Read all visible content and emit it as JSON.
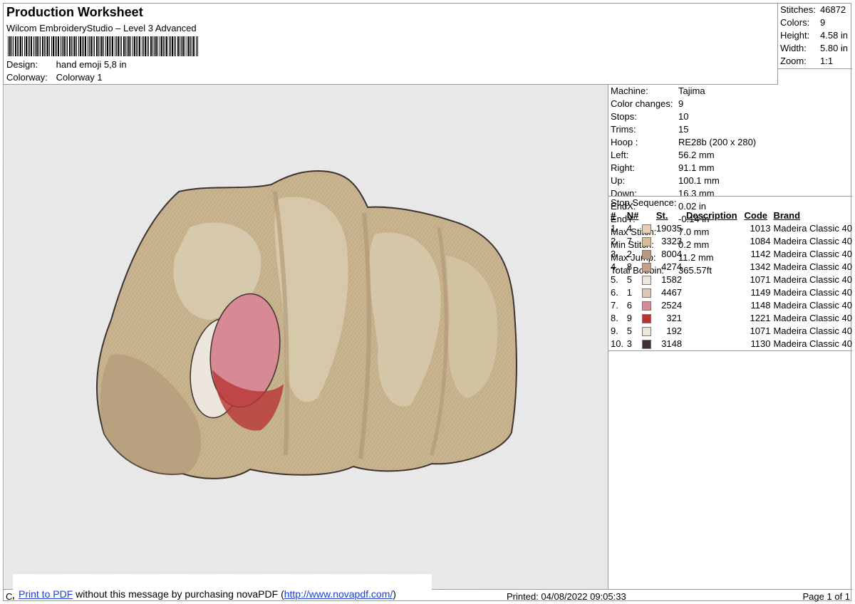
{
  "header": {
    "title": "Production Worksheet",
    "subtitle": "Wilcom EmbroideryStudio – Level 3 Advanced",
    "design_label": "Design:",
    "design_value": "hand emoji 5,8 in",
    "colorway_label": "Colorway:",
    "colorway_value": "Colorway 1"
  },
  "stats": [
    {
      "label": "Stitches:",
      "value": "46872"
    },
    {
      "label": "Colors:",
      "value": "9"
    },
    {
      "label": "Height:",
      "value": "4.58 in"
    },
    {
      "label": "Width:",
      "value": "5.80 in"
    },
    {
      "label": "Zoom:",
      "value": "1:1"
    }
  ],
  "machine_info": [
    {
      "label": "Machine:",
      "value": "Tajima"
    },
    {
      "label": "Color changes:",
      "value": "9"
    },
    {
      "label": "Stops:",
      "value": "10"
    },
    {
      "label": "Trims:",
      "value": "15"
    },
    {
      "label": "Hoop :",
      "value": "RE28b (200 x 280)"
    },
    {
      "label": "Left:",
      "value": "56.2 mm"
    },
    {
      "label": "Right:",
      "value": "91.1 mm"
    },
    {
      "label": "Up:",
      "value": "100.1 mm"
    },
    {
      "label": "Down:",
      "value": "16.3 mm"
    },
    {
      "label": "EndX:",
      "value": "0.02 in"
    },
    {
      "label": "EndY:",
      "value": "-0.14 in"
    },
    {
      "label": "Max Stitch:",
      "value": "7.0 mm"
    },
    {
      "label": "Min Stitch:",
      "value": "0.2 mm"
    },
    {
      "label": "Max Jump:",
      "value": "11.2 mm"
    },
    {
      "label": "Total Bobbin:",
      "value": "365.57ft"
    }
  ],
  "stop_sequence": {
    "title": "Stop Sequence:",
    "headers": {
      "idx": "#",
      "n": "N#",
      "st": "St.",
      "desc": "Description",
      "code": "Code",
      "brand": "Brand"
    },
    "rows": [
      {
        "idx": "1.",
        "n": "4",
        "color": "#e8cdb8",
        "st": "19035",
        "code": "1013",
        "brand": "Madeira Classic 40"
      },
      {
        "idx": "2.",
        "n": "7",
        "color": "#d8bc98",
        "st": "3323",
        "code": "1084",
        "brand": "Madeira Classic 40"
      },
      {
        "idx": "3.",
        "n": "2",
        "color": "#b89884",
        "st": "8004",
        "code": "1142",
        "brand": "Madeira Classic 40"
      },
      {
        "idx": "4.",
        "n": "8",
        "color": "#c4a08a",
        "st": "4274",
        "code": "1342",
        "brand": "Madeira Classic 40"
      },
      {
        "idx": "5.",
        "n": "5",
        "color": "#ece6dc",
        "st": "1582",
        "code": "1071",
        "brand": "Madeira Classic 40"
      },
      {
        "idx": "6.",
        "n": "1",
        "color": "#e0c6b2",
        "st": "4467",
        "code": "1149",
        "brand": "Madeira Classic 40"
      },
      {
        "idx": "7.",
        "n": "6",
        "color": "#d88a94",
        "st": "2524",
        "code": "1148",
        "brand": "Madeira Classic 40"
      },
      {
        "idx": "8.",
        "n": "9",
        "color": "#b83434",
        "st": "321",
        "code": "1221",
        "brand": "Madeira Classic 40"
      },
      {
        "idx": "9.",
        "n": "5",
        "color": "#ece6dc",
        "st": "192",
        "code": "1071",
        "brand": "Madeira Classic 40"
      },
      {
        "idx": "10.",
        "n": "3",
        "color": "#3e3232",
        "st": "3148",
        "code": "1130",
        "brand": "Madeira Classic 40"
      }
    ]
  },
  "footer": {
    "cr": "Cr",
    "printed": "Printed: 04/08/2022 09:05:33",
    "page": "Page 1 of 1"
  },
  "nova": {
    "link1": "Print to PDF",
    "middle": " without this message by purchasing novaPDF (",
    "link2": "http://www.novapdf.com/",
    "end": ")"
  },
  "colors": {
    "skin_light": "#d9cdb0",
    "skin_mid": "#c8b48e",
    "skin_dark": "#ad9472",
    "outline": "#3e3232",
    "nail": "#d88a94",
    "nail_dark": "#b83434"
  }
}
